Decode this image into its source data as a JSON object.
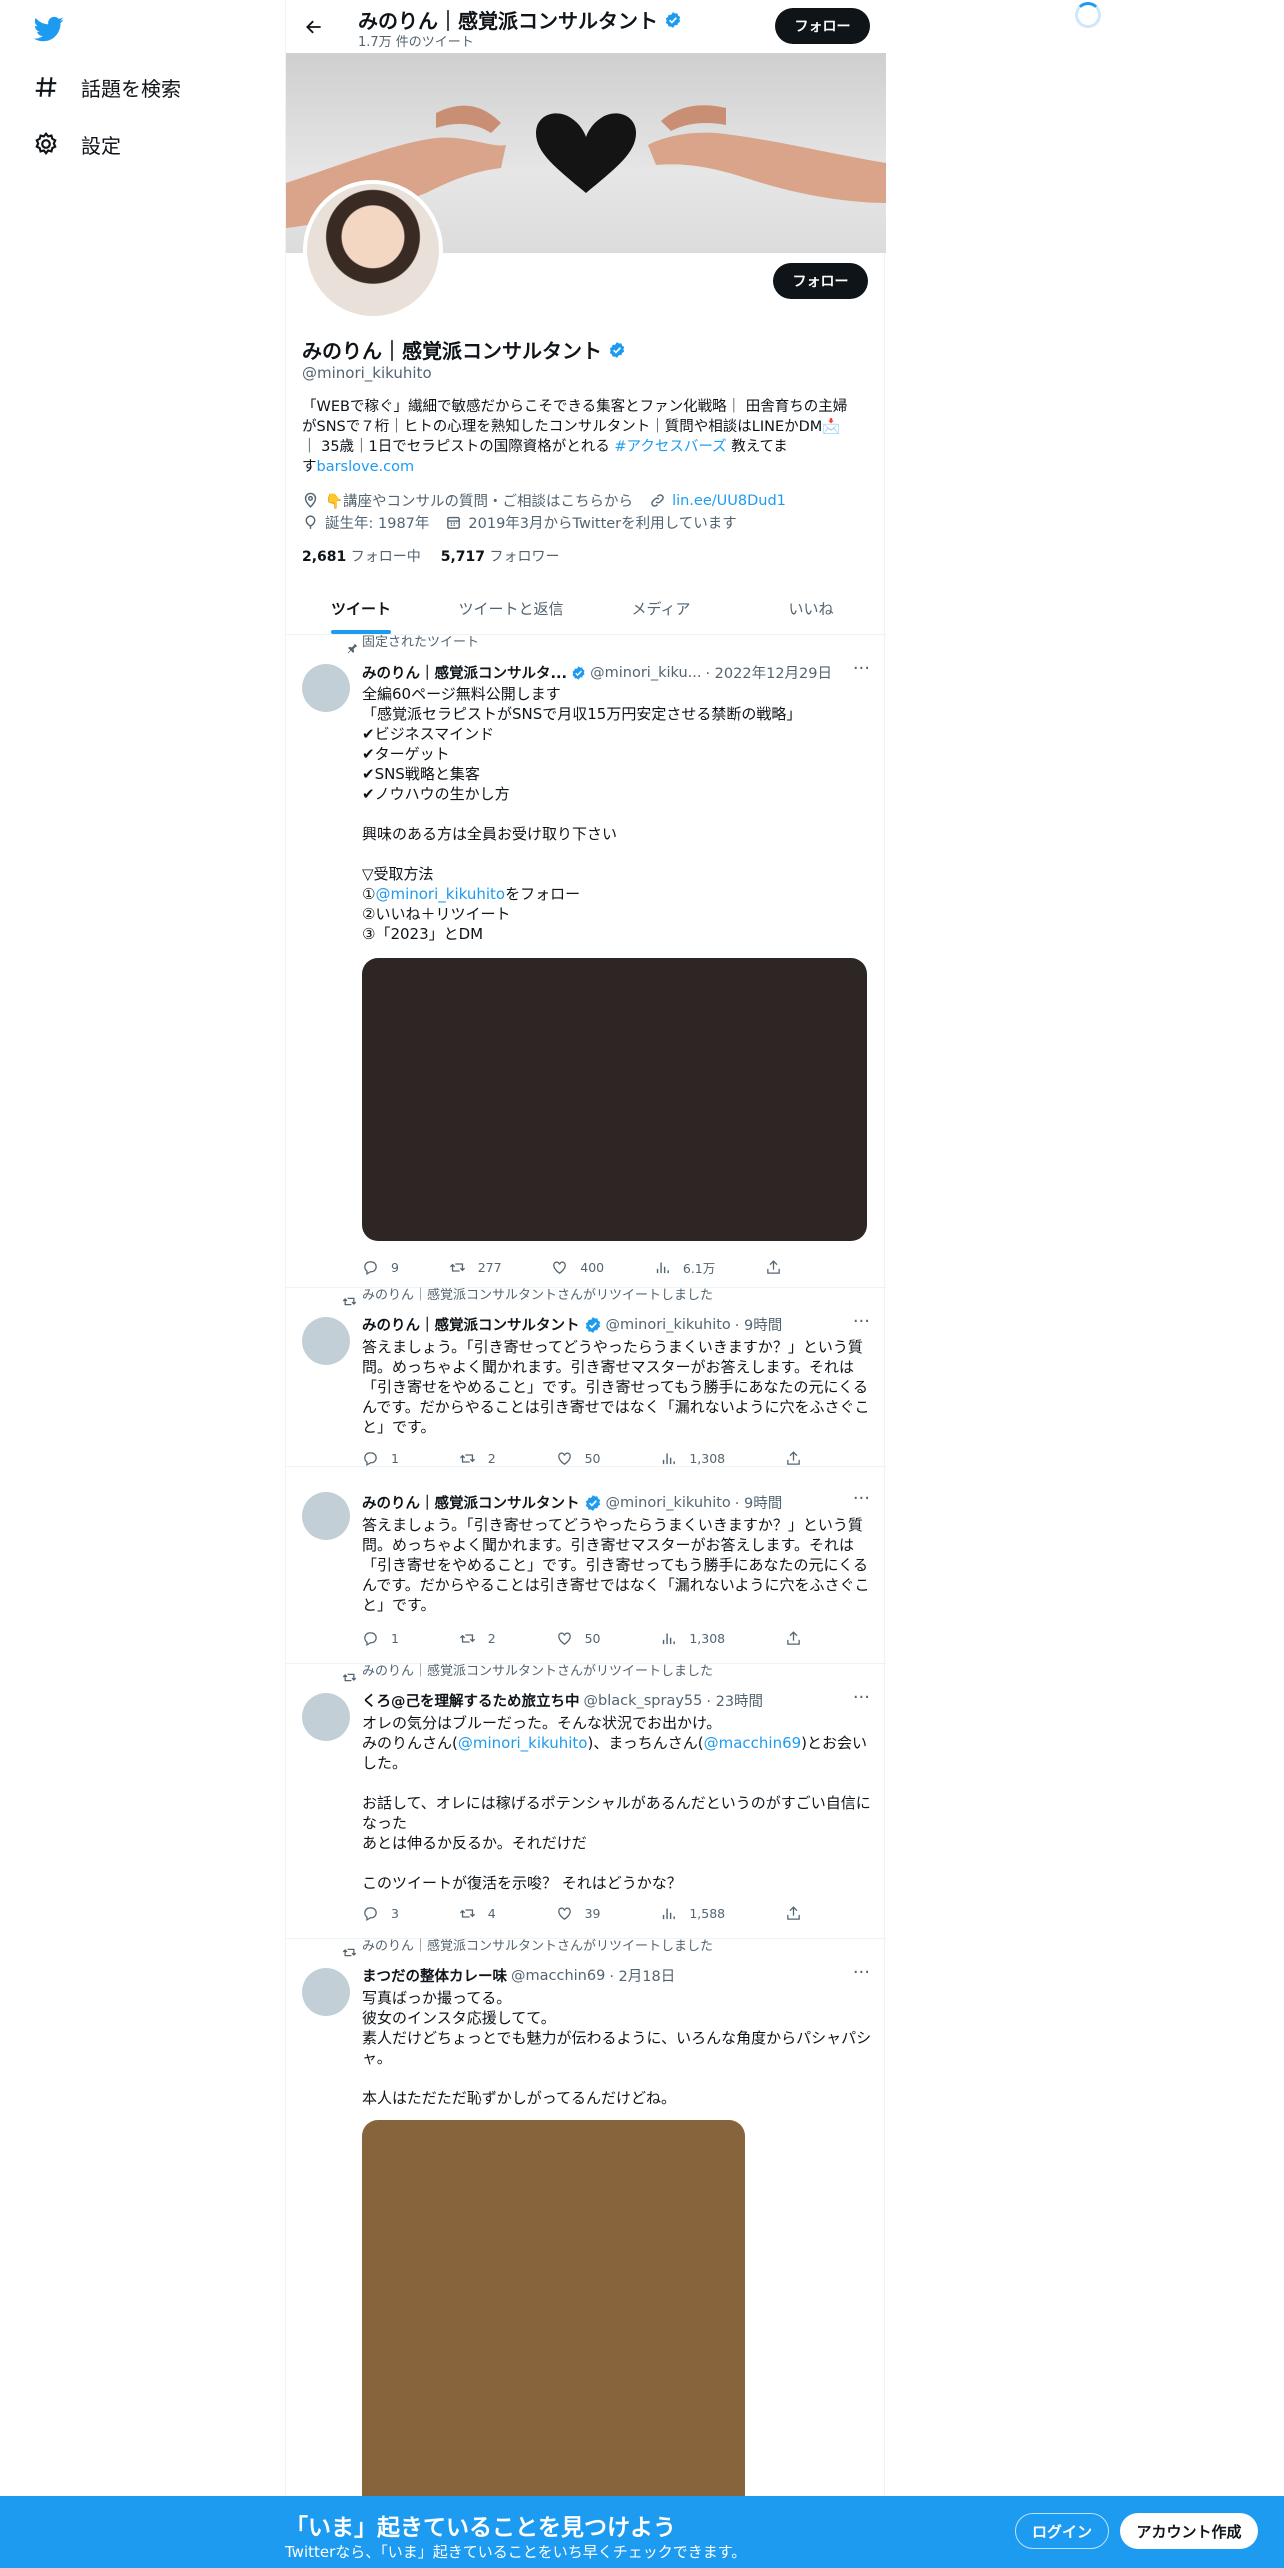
{
  "nav": {
    "items": [
      {
        "label": "話題を検索",
        "icon": "hashtag-icon"
      },
      {
        "label": "設定",
        "icon": "gear-icon"
      }
    ]
  },
  "header": {
    "name": "みのりん｜感覚派コンサルタント",
    "tweet_count": "1.7万 件のツイート",
    "follow_label": "フォロー"
  },
  "profile": {
    "name": "みのりん｜感覚派コンサルタント",
    "handle": "@minori_kikuhito",
    "follow_label": "フォロー",
    "bio_line1": "「WEBで稼ぐ」繊細で敏感だからこそできる集客とファン化戦略｜ 田舎育ちの主婦",
    "bio_line2": "がSNSで７桁｜ヒトの心理を熟知したコンサルタント｜質問や相談はLINEかDM📩",
    "bio_line3": "｜ 35歳｜1日でセラピストの国際資格がとれる ",
    "bio_hashtag": "#アクセスバーズ",
    "bio_line3_end": " 教えてま",
    "bio_line4": "す",
    "bio_link": "barslove.com",
    "location": "👇講座やコンサルの質問・ご相談はこちらから",
    "website": "lin.ee/UU8Dud1",
    "birthday": "誕生年: 1987年",
    "joined": "2019年3月からTwitterを利用しています",
    "following_count": "2,681",
    "following_label": "フォロー中",
    "followers_count": "5,717",
    "followers_label": "フォロワー"
  },
  "tabs": [
    "ツイート",
    "ツイートと返信",
    "メディア",
    "いいね"
  ],
  "tweets": [
    {
      "context": "固定されたツイート",
      "name": "みのりん｜感覚派コンサルタ...",
      "handle": "@minori_kiku...",
      "time": "· 2022年12月29日",
      "text_a": "全編60ページ無料公開します\n「感覚派セラピストがSNSで月収15万円安定させる禁断の戦略」\n✔ビジネスマインド\n✔ターゲット\n✔SNS戦略と集客\n✔ノウハウの生かし方\n\n興味のある方は全員お受け取り下さい\n\n▽受取方法\n①",
      "text_link": "@minori_kikuhito",
      "text_b": "をフォロー\n②いいね＋リツイート\n③「2023」とDM",
      "replies": "9",
      "retweets": "277",
      "likes": "400",
      "views": "6.1万",
      "media_color": "#2e2624"
    },
    {
      "context": "みのりん｜感覚派コンサルタントさんがリツイートしました",
      "name": "みのりん｜感覚派コンサルタント",
      "handle": "@minori_kikuhito",
      "time": "· 9時間",
      "text": "答えましょう。「引き寄せってどうやったらうまくいきますか？」という質問。めっちゃよく聞かれます。引き寄せマスターがお答えします。それは「引き寄せをやめること」です。引き寄せってもう勝手にあなたの元にくるんです。だからやることは引き寄せではなく「漏れないように穴をふさぐこと」です。",
      "replies": "1",
      "retweets": "2",
      "likes": "50",
      "views": "1,308"
    },
    {
      "name": "みのりん｜感覚派コンサルタント",
      "handle": "@minori_kikuhito",
      "time": "· 9時間",
      "text": "答えましょう。「引き寄せってどうやったらうまくいきますか？」という質問。めっちゃよく聞かれます。引き寄せマスターがお答えします。それは「引き寄せをやめること」です。引き寄せってもう勝手にあなたの元にくるんです。だからやることは引き寄せではなく「漏れないように穴をふさぐこと」です。",
      "replies": "1",
      "retweets": "2",
      "likes": "50",
      "views": "1,308"
    },
    {
      "context": "みのりん｜感覚派コンサルタントさんがリツイートしました",
      "name": "くろ@己を理解するため旅立ち中",
      "handle": "@black_spray55",
      "time": "· 23時間",
      "text_a": "オレの気分はブルーだった。そんな状況でお出かけ。\nみのりんさん(",
      "link1": "@minori_kikuhito",
      "text_b": ")、まっちんさん(",
      "link2": "@macchin69",
      "text_c": ")とお会いした。\n\nお話して、オレには稼げるポテンシャルがあるんだというのがすごい自信になった\nあとは伸るか反るか。それだけだ\n\nこのツイートが復活を示唆？ それはどうかな？",
      "replies": "3",
      "retweets": "4",
      "likes": "39",
      "views": "1,588"
    },
    {
      "context": "みのりん｜感覚派コンサルタントさんがリツイートしました",
      "name": "まつだの整体カレー味",
      "handle": "@macchin69",
      "time": "· 2月18日",
      "text": "写真ばっか撮ってる。\n彼女のインスタ応援してて。\n素人だけどちょっとでも魅力が伝わるように、いろんな角度からパシャパシャ。\n\n本人はただただ恥ずかしがってるんだけどね。",
      "media_color": "#87643c"
    }
  ],
  "bottom": {
    "title": "「いま」起きていることを見つけよう",
    "subtitle": "Twitterなら、「いま」起きていることをいち早くチェックできます。",
    "login": "ログイン",
    "signup": "アカウント作成"
  },
  "colors": {
    "accent": "#1d9bf0",
    "text": "#0f1419",
    "muted": "#536471"
  }
}
